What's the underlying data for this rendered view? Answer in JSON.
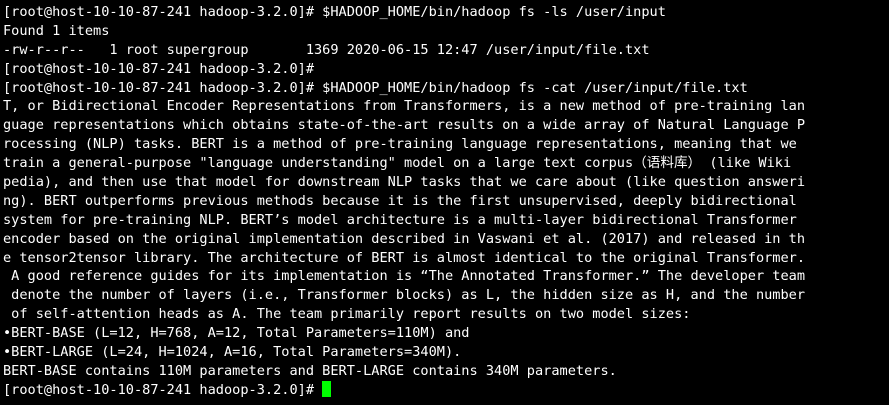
{
  "terminal": {
    "colors": {
      "background": "#000000",
      "foreground": "#ffffff",
      "cursor": "#00ff00"
    },
    "lines": [
      "[root@host-10-10-87-241 hadoop-3.2.0]# $HADOOP_HOME/bin/hadoop fs -ls /user/input",
      "Found 1 items",
      "-rw-r--r--   1 root supergroup       1369 2020-06-15 12:47 /user/input/file.txt",
      "[root@host-10-10-87-241 hadoop-3.2.0]#",
      "[root@host-10-10-87-241 hadoop-3.2.0]# $HADOOP_HOME/bin/hadoop fs -cat /user/input/file.txt",
      "T, or Bidirectional Encoder Representations from Transformers, is a new method of pre-training lan",
      "guage representations which obtains state-of-the-art results on a wide array of Natural Language P",
      "rocessing (NLP) tasks. BERT is a method of pre-training language representations, meaning that we",
      "train a general-purpose \"language understanding\" model on a large text corpus（语料库） (like Wiki",
      "pedia), and then use that model for downstream NLP tasks that we care about (like question answeri",
      "ng). BERT outperforms previous methods because it is the first unsupervised, deeply bidirectional",
      "system for pre-training NLP. BERT’s model architecture is a multi-layer bidirectional Transformer",
      "encoder based on the original implementation described in Vaswani et al. (2017) and released in th",
      "e tensor2tensor library. The architecture of BERT is almost identical to the original Transformer.",
      " A good reference guides for its implementation is “The Annotated Transformer.” The developer team",
      " denote the number of layers (i.e., Transformer blocks) as L, the hidden size as H, and the number",
      " of self-attention heads as A. The team primarily report results on two model sizes:",
      "•BERT-BASE (L=12, H=768, A=12, Total Parameters=110M) and",
      "•BERT-LARGE (L=24, H=1024, A=16, Total Parameters=340M).",
      "BERT-BASE contains 110M parameters and BERT-LARGE contains 340M parameters."
    ],
    "prompt": "[root@host-10-10-87-241 hadoop-3.2.0]# "
  }
}
